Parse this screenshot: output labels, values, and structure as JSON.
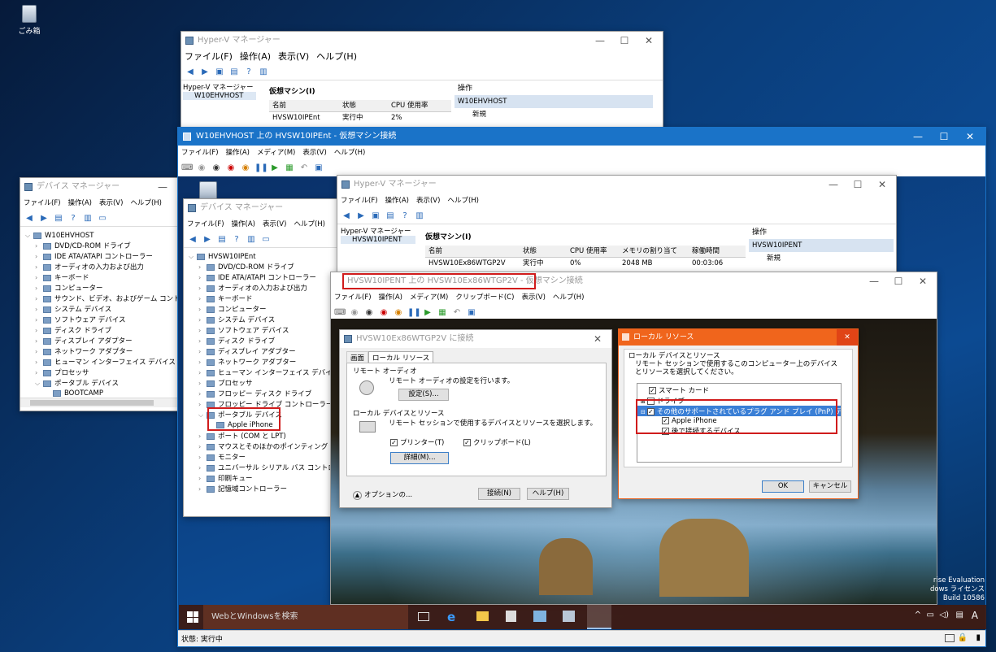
{
  "desktop": {
    "recycle_label": "ごみ箱"
  },
  "hyperv_back": {
    "title": "Hyper-V マネージャー",
    "menu": [
      "ファイル(F)",
      "操作(A)",
      "表示(V)",
      "ヘルプ(H)"
    ],
    "tree": [
      "Hyper-V マネージャー",
      "W10EHVHOST"
    ],
    "vm_header": "仮想マシン(I)",
    "cols": [
      "名前",
      "状態",
      "CPU 使用率"
    ],
    "row": [
      "HVSW10IPEnt",
      "実行中",
      "2%"
    ],
    "ops_header": "操作",
    "ops_host": "W10EHVHOST",
    "ops_new": "新規"
  },
  "devmgr_host": {
    "title": "デバイス マネージャー",
    "menu": [
      "ファイル(F)",
      "操作(A)",
      "表示(V)",
      "ヘルプ(H)"
    ],
    "root": "W10EHVHOST",
    "items": [
      "DVD/CD-ROM ドライブ",
      "IDE ATA/ATAPI コントローラー",
      "オーディオの入力および出力",
      "キーボード",
      "コンピューター",
      "サウンド、ビデオ、およびゲーム コントローラー",
      "システム デバイス",
      "ソフトウェア デバイス",
      "ディスク ドライブ",
      "ディスプレイ アダプター",
      "ネットワーク アダプター",
      "ヒューマン インターフェイス デバイス",
      "プロセッサ",
      "ポータブル デバイス"
    ],
    "child": "BOOTCAMP"
  },
  "vmconn": {
    "title": "W10EHVHOST 上の HVSW10IPEnt - 仮想マシン接続",
    "menu": [
      "ファイル(F)",
      "操作(A)",
      "メディア(M)",
      "表示(V)",
      "ヘルプ(H)"
    ],
    "status": "状態: 実行中"
  },
  "devmgr_guest": {
    "title": "デバイス マネージャー",
    "menu": [
      "ファイル(F)",
      "操作(A)",
      "表示(V)",
      "ヘルプ(H)"
    ],
    "root": "HVSW10IPEnt",
    "items": [
      "DVD/CD-ROM ドライブ",
      "IDE ATA/ATAPI コントローラー",
      "オーディオの入力および出力",
      "キーボード",
      "コンピューター",
      "システム デバイス",
      "ソフトウェア デバイス",
      "ディスク ドライブ",
      "ディスプレイ アダプター",
      "ネットワーク アダプター",
      "ヒューマン インターフェイス デバイス",
      "プロセッサ",
      "フロッピー ディスク ドライブ",
      "フロッピー ドライブ コントローラー",
      "ポータブル デバイス"
    ],
    "child": "Apple iPhone",
    "items2": [
      "ポート (COM と LPT)",
      "マウスとそのほかのポインティング デバイス",
      "モニター",
      "ユニバーサル シリアル バス コントローラー",
      "印刷キュー",
      "記憶域コントローラー"
    ]
  },
  "hyperv_inner": {
    "title": "Hyper-V マネージャー",
    "menu": [
      "ファイル(F)",
      "操作(A)",
      "表示(V)",
      "ヘルプ(H)"
    ],
    "tree": [
      "Hyper-V マネージャー",
      "HVSW10IPENT"
    ],
    "vm_header": "仮想マシン(I)",
    "cols": [
      "名前",
      "状態",
      "CPU 使用率",
      "メモリの割り当て",
      "稼働時間"
    ],
    "row": [
      "HVSW10Ex86WTGP2V",
      "実行中",
      "0%",
      "2048 MB",
      "00:03:06"
    ],
    "ops_header": "操作",
    "ops_host": "HVSW10IPENT",
    "ops_new": "新規"
  },
  "vmconn_inner": {
    "title": "HVSW10IPENT 上の HVSW10Ex86WTGP2V - 仮想マシン接続",
    "menu": [
      "ファイル(F)",
      "操作(A)",
      "メディア(M)",
      "クリップボード(C)",
      "表示(V)",
      "ヘルプ(H)"
    ]
  },
  "rdp": {
    "title": "HVSW10Ex86WTGP2V に接続",
    "tabs": [
      "画面",
      "ローカル リソース"
    ],
    "audio_group": "リモート オーディオ",
    "audio_desc": "リモート オーディオの設定を行います。",
    "settings_btn": "設定(S)...",
    "local_group": "ローカル デバイスとリソース",
    "local_desc": "リモート セッションで使用するデバイスとリソースを選択します。",
    "printer": "プリンター(T)",
    "clipboard": "クリップボード(L)",
    "details_btn": "詳細(M)...",
    "options": "オプションの...",
    "connect_btn": "接続(N)",
    "help_btn": "ヘルプ(H)"
  },
  "localres": {
    "title": "ローカル リソース",
    "group": "ローカル デバイスとリソース",
    "desc": "リモート セッションで使用するこのコンピューター上のデバイスとリソースを選択してください。",
    "items": [
      "スマート カード",
      "ドライブ",
      "その他のサポートされているプラグ アンド プレイ (PnP) デバイス",
      "Apple iPhone",
      "後で接続するデバイス"
    ],
    "ok": "OK",
    "cancel": "キャンセル"
  },
  "guest_taskbar": {
    "search": "WebとWindowsを検索"
  },
  "watermark": [
    "rise Evaluation",
    "dows ライセンス",
    "Build 10586"
  ]
}
